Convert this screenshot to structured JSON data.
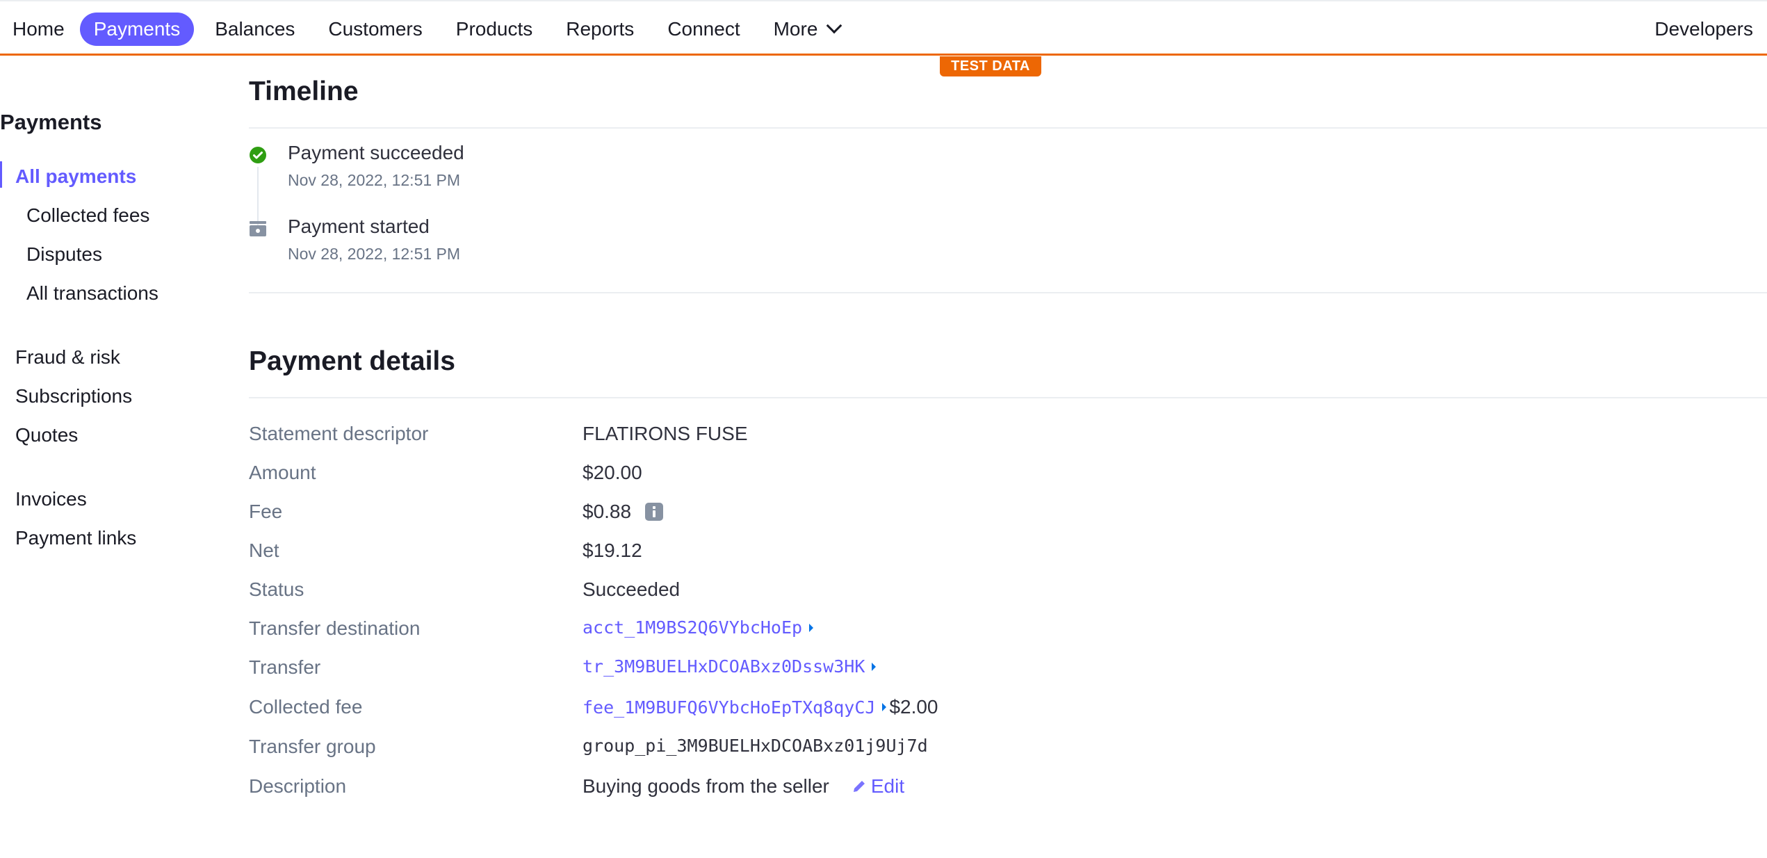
{
  "nav": {
    "items": [
      {
        "label": "Home",
        "active": false
      },
      {
        "label": "Payments",
        "active": true
      },
      {
        "label": "Balances",
        "active": false
      },
      {
        "label": "Customers",
        "active": false
      },
      {
        "label": "Products",
        "active": false
      },
      {
        "label": "Reports",
        "active": false
      },
      {
        "label": "Connect",
        "active": false
      },
      {
        "label": "More",
        "active": false,
        "icon": "chevron-down-icon"
      }
    ],
    "right_label": "Developers",
    "accent_color": "#635bff",
    "test_mode_color": "#ed6704"
  },
  "test_badge": "TEST DATA",
  "sidebar": {
    "title": "Payments",
    "items": [
      {
        "label": "All payments",
        "active": true
      },
      {
        "label": "Collected fees"
      },
      {
        "label": "Disputes"
      },
      {
        "label": "All transactions"
      },
      {
        "label": "Fraud & risk"
      },
      {
        "label": "Subscriptions"
      },
      {
        "label": "Quotes"
      },
      {
        "label": "Invoices"
      },
      {
        "label": "Payment links"
      }
    ]
  },
  "timeline": {
    "title": "Timeline",
    "events": [
      {
        "title": "Payment succeeded",
        "time": "Nov 28, 2022, 12:51 PM",
        "icon": "check-circle-icon",
        "color": "#2f9e12"
      },
      {
        "title": "Payment started",
        "time": "Nov 28, 2022, 12:51 PM",
        "icon": "payment-icon",
        "color": "#8792a2"
      }
    ]
  },
  "details": {
    "title": "Payment details",
    "rows": [
      {
        "label": "Statement descriptor",
        "value": "FLATIRONS FUSE"
      },
      {
        "label": "Amount",
        "value": "$20.00"
      },
      {
        "label": "Fee",
        "value": "$0.88",
        "icon": "info-icon"
      },
      {
        "label": "Net",
        "value": "$19.12"
      },
      {
        "label": "Status",
        "value": "Succeeded"
      },
      {
        "label": "Transfer destination",
        "value": "acct_1M9BS2Q6VYbcHoEp"
      },
      {
        "label": "Transfer",
        "value": "tr_3M9BUELHxDCOABxz0Dssw3HK"
      },
      {
        "label": "Collected fee",
        "value": "fee_1M9BUFQ6VYbcHoEpTXq8qyCJ",
        "suffix": "$2.00"
      },
      {
        "label": "Transfer group",
        "value": "group_pi_3M9BUELHxDCOABxz01j9Uj7d"
      },
      {
        "label": "Description",
        "value": "Buying goods from the seller",
        "action": "Edit"
      }
    ]
  }
}
